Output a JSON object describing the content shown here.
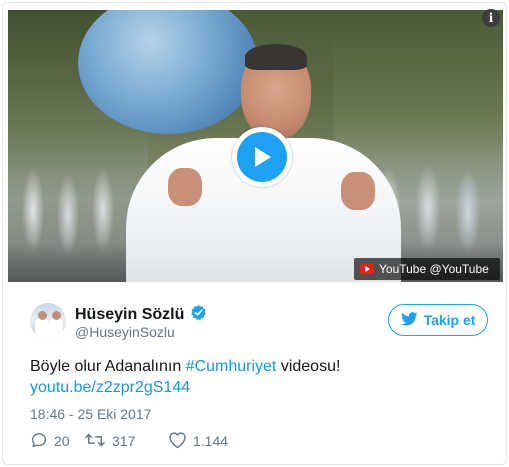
{
  "video": {
    "source_badge": "YouTube @YouTube",
    "play_icon": "play-icon",
    "source_icon": "youtube-icon"
  },
  "info_glyph": "i",
  "author": {
    "name": "Hüseyin Sözlü",
    "handle": "@HuseyinSozlu",
    "verified_icon": "verified-badge-icon"
  },
  "follow_button": {
    "label": "Takip et",
    "icon": "twitter-bird-icon"
  },
  "tweet": {
    "text_before": "Böyle olur Adanalının ",
    "hashtag": "#Cumhuriyet",
    "text_after": " videosu!",
    "link": "youtu.be/z2zpr2gS144",
    "timestamp": "18:46 - 25 Eki 2017"
  },
  "stats": {
    "replies": "20",
    "retweets": "317",
    "likes": "1.144"
  },
  "colors": {
    "accent": "#1da1f2",
    "link": "#1b95e0",
    "muted": "#657786",
    "text": "#14171a",
    "youtube_red": "#e62117"
  }
}
